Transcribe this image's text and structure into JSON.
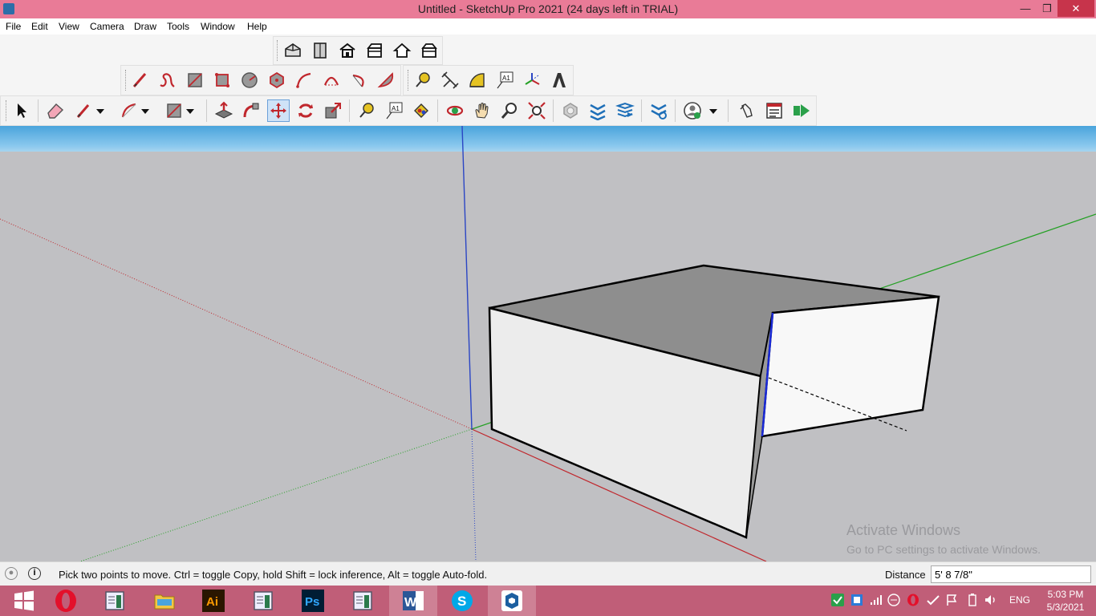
{
  "window": {
    "title": "Untitled - SketchUp Pro 2021 (24 days left in TRIAL)",
    "minimize": "—",
    "maximize": "❐",
    "close": "✕"
  },
  "menu": [
    "File",
    "Edit",
    "View",
    "Camera",
    "Draw",
    "Tools",
    "Window",
    "Help"
  ],
  "toolbars": {
    "views": [
      "iso-view-icon",
      "top-view-icon",
      "front-view-icon",
      "right-view-icon",
      "back-view-icon",
      "left-view-icon"
    ],
    "drawing": [
      "line-icon",
      "freehand-icon",
      "rectangle-icon",
      "rotated-rectangle-icon",
      "circle-icon",
      "polygon-icon",
      "arc-icon",
      "2-point-arc-icon",
      "3-point-arc-icon",
      "pie-icon"
    ],
    "construction": [
      "tape-measure-icon",
      "dimension-icon",
      "protractor-icon",
      "text-icon",
      "axes-icon",
      "3d-text-icon"
    ],
    "text_tool_label": "A1",
    "main": [
      "select-icon",
      "eraser-icon",
      "pencil-icon",
      "arc-tool-icon",
      "rectangle-tool-icon",
      "push-pull-icon",
      "follow-me-icon",
      "move-icon",
      "rotate-icon",
      "scale-icon",
      "tape-icon",
      "text-tool-icon",
      "paint-bucket-icon",
      "orbit-icon",
      "pan-icon",
      "zoom-icon",
      "zoom-extents-icon",
      "warehouse-icon",
      "extension-warehouse-icon",
      "layout-icon",
      "extension-manager-icon",
      "account-icon",
      "undo-icon",
      "model-info-icon",
      "play-icon"
    ]
  },
  "viewport": {
    "watermark_title": "Activate Windows",
    "watermark_sub": "Go to PC settings to activate Windows."
  },
  "status": {
    "message": "Pick two points to move.  Ctrl = toggle Copy, hold Shift = lock inference, Alt = toggle Auto-fold.",
    "info_icon": "i",
    "distance_label": "Distance",
    "distance_value": "5' 8 7/8\""
  },
  "taskbar": {
    "apps": [
      "start-icon",
      "opera-icon",
      "notepad-icon",
      "file-explorer-icon",
      "illustrator-icon",
      "notepad2-icon",
      "photoshop-icon",
      "notepad3-icon",
      "word-icon",
      "skype-icon",
      "sketchup-icon"
    ],
    "ai_label": "Ai",
    "ps_label": "Ps",
    "word_label": "W",
    "skype_label": "S",
    "lang": "ENG",
    "time": "5:03 PM",
    "date": "5/3/2021"
  }
}
